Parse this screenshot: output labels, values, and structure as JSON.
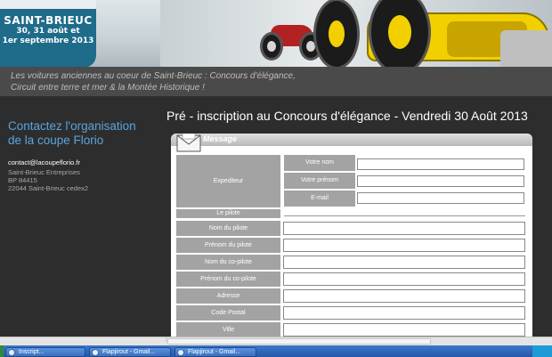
{
  "banner": {
    "city": "SAINT-BRIEUC",
    "dates_line1": "30, 31 août et",
    "dates_line2": "1er septembre 2013",
    "tagline_line1": "Les voitures anciennes au coeur de Saint-Brieuc : Concours d'élégance,",
    "tagline_line2": "Circuit entre terre et mer & la Montée Historique !"
  },
  "sidebar": {
    "title_line1": "Contactez l'organisation",
    "title_line2": "de la coupe Florio",
    "email": "contact@lacoupeflorio.fr",
    "address": [
      "Saint-Brieuc Entreprises",
      "BP 84415",
      "22044 Saint-Brieuc cedex2"
    ]
  },
  "main": {
    "heading": "Pré - inscription au Concours d'élégance - Vendredi 30 Août 2013",
    "panel_title": "Message"
  },
  "form": {
    "expediteur_label": "Expediteur",
    "expediteur_fields": [
      {
        "label": "Votre nom",
        "value": ""
      },
      {
        "label": "Votre prénom",
        "value": ""
      },
      {
        "label": "E-mail",
        "value": ""
      }
    ],
    "section_pilote": "Le pilote",
    "pilote_fields": [
      {
        "label": "Nom du pilote",
        "value": ""
      },
      {
        "label": "Prénom du pilote",
        "value": ""
      },
      {
        "label": "Nom du co-pilote",
        "value": ""
      },
      {
        "label": "Prénom du co-pilote",
        "value": ""
      },
      {
        "label": "Adresse",
        "value": ""
      },
      {
        "label": "Code Postal",
        "value": ""
      },
      {
        "label": "Ville",
        "value": ""
      }
    ]
  },
  "taskbar": {
    "tasks": [
      "Inscript...",
      "Flapjirout - Gmail...",
      "Flapjirout - Gmail..."
    ]
  },
  "colors": {
    "accent": "#5aa4de",
    "label_bg": "#a3a3a3",
    "badge": "#1f6b8a"
  }
}
